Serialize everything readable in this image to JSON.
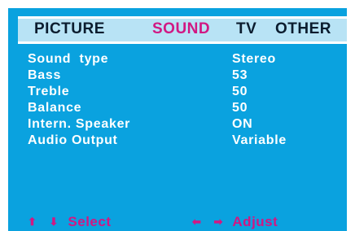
{
  "menu": {
    "tabs": [
      {
        "label": "PICTURE"
      },
      {
        "label": "SOUND"
      },
      {
        "label": "TV"
      },
      {
        "label": "OTHER"
      }
    ],
    "active_tab": "SOUND"
  },
  "settings": [
    {
      "label": "Sound  type",
      "value": "Stereo"
    },
    {
      "label": "Bass",
      "value": "53"
    },
    {
      "label": "Treble",
      "value": "50"
    },
    {
      "label": "Balance",
      "value": "50"
    },
    {
      "label": "Intern. Speaker",
      "value": "ON"
    },
    {
      "label": "Audio Output",
      "value": "Variable"
    }
  ],
  "footer": {
    "select_arrows": "⬆ ⬇",
    "select_label": "Select",
    "adjust_arrows": "⬅ ➡",
    "adjust_label": "Adjust"
  },
  "colors": {
    "background": "#0aa2df",
    "tabbar": "#b8e3f5",
    "active_tab": "#d11883",
    "text": "#ffffff"
  }
}
